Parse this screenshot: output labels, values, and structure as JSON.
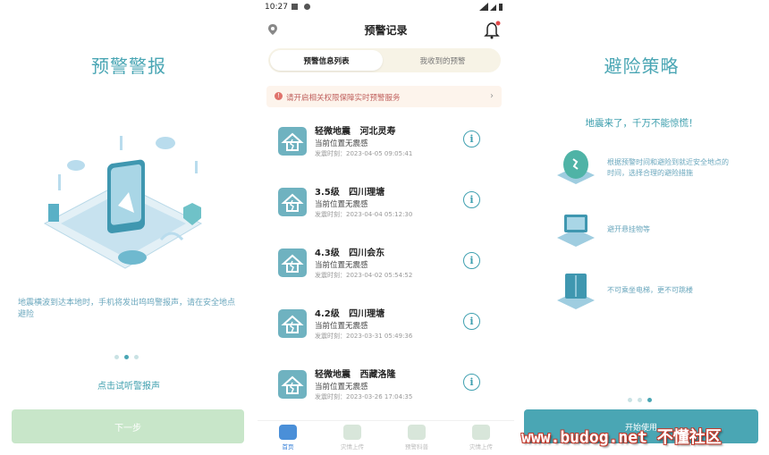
{
  "left_panel": {
    "title": "预警警报",
    "description": "地震横波到达本地时，手机将发出呜呜警报声，请在安全地点避险",
    "listen_link": "点击试听警报声",
    "next_button": "下一步"
  },
  "middle_panel": {
    "status_time": "10:27",
    "header_title": "预警记录",
    "tabs": [
      {
        "label": "预警信息列表",
        "active": true
      },
      {
        "label": "我收到的预警",
        "active": false
      }
    ],
    "notice": "请开启相关权限保障实时预警服务",
    "items": [
      {
        "title": "轻微地震   河北灵寿",
        "status": "当前位置无震感",
        "time": "发震时刻：2023-04-05 09:05:41"
      },
      {
        "title": "3.5级   四川理塘",
        "status": "当前位置无震感",
        "time": "发震时刻：2023-04-04 05:12:30"
      },
      {
        "title": "4.3级   四川会东",
        "status": "当前位置无震感",
        "time": "发震时刻：2023-04-02 05:54:52"
      },
      {
        "title": "4.2级   四川理塘",
        "status": "当前位置无震感",
        "time": "发震时刻：2023-03-31 05:49:36"
      },
      {
        "title": "轻微地震   西藏洛隆",
        "status": "当前位置无震感",
        "time": "发震时刻：2023-03-26 17:04:35"
      }
    ],
    "bottom_nav": [
      {
        "label": "首页",
        "active": true
      },
      {
        "label": "灾情上传",
        "active": false
      },
      {
        "label": "预警科普",
        "active": false
      },
      {
        "label": "灾情上传",
        "active": false
      }
    ]
  },
  "right_panel": {
    "title": "避险策略",
    "subtitle": "地震来了，千万不能惊慌！",
    "tips": [
      "根据预警时间和避险到就近安全地点的时间，选择合理的避险措施",
      "避开悬挂物等",
      "不可乘坐电梯，更不可跳楼"
    ],
    "start_button": "开始使用"
  },
  "watermark": "www.budog.net 不懂社区",
  "colors": {
    "accent": "#4aa6b4",
    "notice_bg": "#fdf4ec",
    "notice_text": "#c0605d",
    "next_button_bg": "#c8e6c9"
  }
}
